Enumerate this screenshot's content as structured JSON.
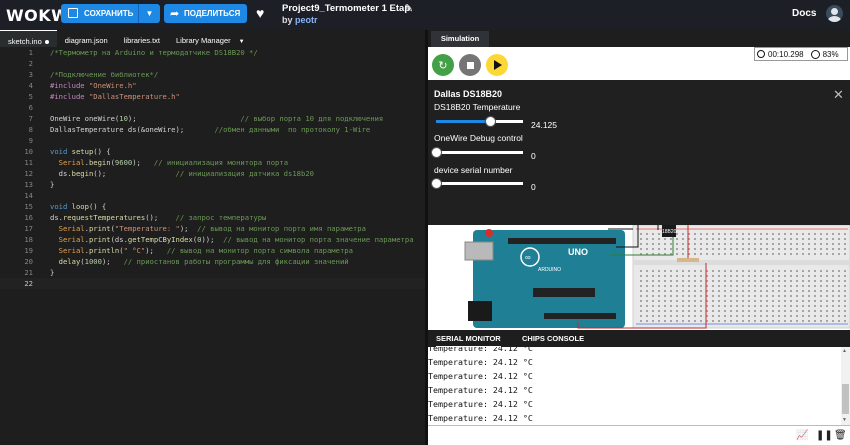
{
  "topbar": {
    "logo": "WOKWI",
    "save_label": "СОХРАНИТЬ",
    "share_label": "ПОДЕЛИТЬСЯ",
    "project_title": "Project9_Termometer 1 Etap",
    "by_prefix": "by",
    "author": "peotr",
    "docs_label": "Docs"
  },
  "editor": {
    "tabs": [
      {
        "label": "sketch.ino",
        "active": true,
        "modified": true
      },
      {
        "label": "diagram.json"
      },
      {
        "label": "libraries.txt"
      },
      {
        "label": "Library Manager",
        "dropdown": true
      }
    ],
    "lines": [
      {
        "n": "1",
        "text": "/*Термометр на Arduino и термодатчике DS18B20 */"
      },
      {
        "n": "2",
        "text": ""
      },
      {
        "n": "3",
        "text": "/*Подключение библиотек*/"
      },
      {
        "n": "4",
        "text": "#include \"OneWire.h\""
      },
      {
        "n": "5",
        "text": "#include \"DallasTemperature.h\""
      },
      {
        "n": "6",
        "text": ""
      },
      {
        "n": "7",
        "text": "OneWire oneWire(10);                        // выбор порта 10 для подключения"
      },
      {
        "n": "8",
        "text": "DallasTemperature ds(&oneWire);       //обмен данными  по протоколу 1-Wire"
      },
      {
        "n": "9",
        "text": ""
      },
      {
        "n": "10",
        "text": "void setup() {"
      },
      {
        "n": "11",
        "text": "  Serial.begin(9600);   // инициализация монитора порта"
      },
      {
        "n": "12",
        "text": "  ds.begin();                // инициализация датчика ds18b20"
      },
      {
        "n": "13",
        "text": "}"
      },
      {
        "n": "14",
        "text": ""
      },
      {
        "n": "15",
        "text": "void loop() {"
      },
      {
        "n": "16",
        "text": "ds.requestTemperatures();    // запрос температуры"
      },
      {
        "n": "17",
        "text": "  Serial.print(\"Temperature: \");  // вывод на монитор порта имя параметра"
      },
      {
        "n": "18",
        "text": "  Serial.print(ds.getTempCByIndex(0));  // вывод на монитор порта значение параметра"
      },
      {
        "n": "19",
        "text": "  Serial.println(\" °C\");   // вывод на монитор порта символа параметра"
      },
      {
        "n": "20",
        "text": "  delay(1000);   // приостанов работы программы для фиксации значений"
      },
      {
        "n": "21",
        "text": "}"
      },
      {
        "n": "22",
        "text": ""
      }
    ]
  },
  "simulation": {
    "tab_label": "Simulation",
    "timer": "00:10.298",
    "cpu": "83%",
    "panel": {
      "title": "Dallas DS18B20",
      "fields": [
        {
          "label": "DS18B20 Temperature",
          "value": "24.125",
          "fraction": 0.62
        },
        {
          "label": "OneWire Debug control",
          "value": "0",
          "fraction": 0
        },
        {
          "label": "device serial number",
          "value": "0",
          "fraction": 0
        }
      ]
    },
    "board": {
      "brand": "ARDUINO",
      "model": "UNO",
      "sensor_label": "18B20"
    }
  },
  "monitor": {
    "tabs": [
      {
        "label": "SERIAL MONITOR",
        "active": true
      },
      {
        "label": "CHIPS CONSOLE"
      }
    ],
    "lines": [
      "Temperature: 24.12 °C",
      "Temperature: 24.12 °C",
      "Temperature: 24.12 °C",
      "Temperature: 24.12 °C",
      "Temperature: 24.12 °C",
      "Temperature: 24.12 °C"
    ]
  },
  "colors": {
    "accent": "#1e88e5",
    "run_green": "#43a047",
    "play_yellow": "#fdd835",
    "arduino_teal": "#1f7f95"
  }
}
